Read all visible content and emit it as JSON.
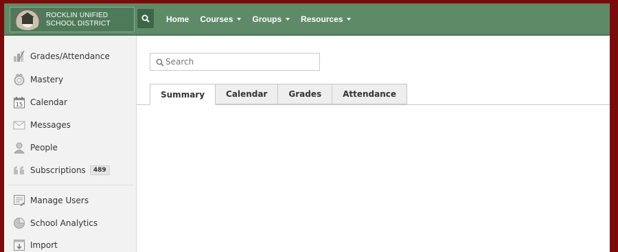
{
  "header": {
    "logo_line1": "ROCKLIN UNIFIED",
    "logo_line2": "SCHOOL DISTRICT",
    "search_icon": "search-icon",
    "nav": [
      {
        "label": "Home",
        "dropdown": false
      },
      {
        "label": "Courses",
        "dropdown": true
      },
      {
        "label": "Groups",
        "dropdown": true
      },
      {
        "label": "Resources",
        "dropdown": true
      }
    ]
  },
  "sidebar": {
    "items": [
      {
        "label": "Grades/Attendance",
        "icon": "grades-icon"
      },
      {
        "label": "Mastery",
        "icon": "mastery-icon"
      },
      {
        "label": "Calendar",
        "icon": "calendar-icon",
        "icon_text": "15"
      },
      {
        "label": "Messages",
        "icon": "envelope-icon"
      },
      {
        "label": "People",
        "icon": "person-icon"
      },
      {
        "label": "Subscriptions",
        "icon": "quote-icon",
        "badge": "489"
      },
      {
        "label": "Manage Users",
        "icon": "manage-users-icon"
      },
      {
        "label": "School Analytics",
        "icon": "pie-chart-icon"
      },
      {
        "label": "Import",
        "icon": "import-icon"
      }
    ]
  },
  "main": {
    "search_placeholder": "Search",
    "tabs": [
      {
        "label": "Summary",
        "active": true
      },
      {
        "label": "Calendar",
        "active": false
      },
      {
        "label": "Grades",
        "active": false
      },
      {
        "label": "Attendance",
        "active": false
      }
    ]
  },
  "colors": {
    "page_border": "#7b0a0a",
    "header_bg": "#5e8a68",
    "sidebar_bg": "#f2f2f2"
  }
}
